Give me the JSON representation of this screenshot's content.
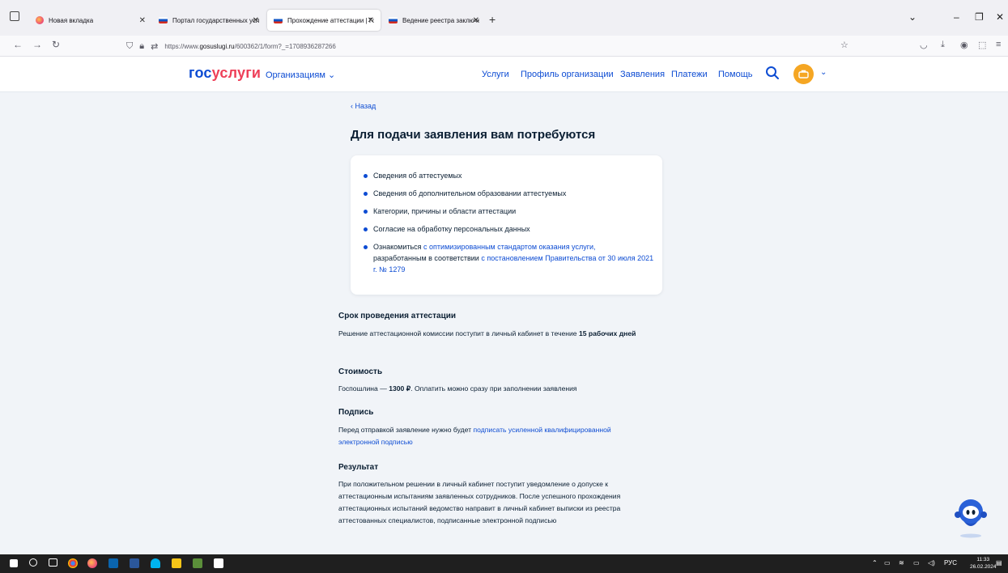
{
  "browser": {
    "tabs": [
      {
        "label": "Новая вкладка",
        "favicon": "firefox-icon",
        "active": false
      },
      {
        "label": "Портал государственных услуг",
        "favicon": "gosuslugi-flag-icon",
        "active": false
      },
      {
        "label": "Прохождение аттестации | Гос",
        "favicon": "gosuslugi-flag-icon",
        "active": true
      },
      {
        "label": "Ведение реестра заключений",
        "favicon": "gosuslugi-flag-icon",
        "active": false
      }
    ],
    "url_prefix": "https://www.",
    "url_domain": "gosuslugi.ru",
    "url_path": "/600362/1/form?_=1708936287266"
  },
  "site": {
    "logo_part1": "гос",
    "logo_part2": "услуги",
    "org_menu": "Организациям",
    "nav": [
      "Услуги",
      "Профиль организации",
      "Заявления",
      "Платежи",
      "Помощь"
    ],
    "accent": "#0d4cd3",
    "brand_red": "#ee3f58"
  },
  "page": {
    "back": "Назад",
    "title": "Для подачи заявления вам потребуются",
    "requirements": [
      "Сведения об аттестуемых",
      "Сведения об дополнительном образовании аттестуемых",
      "Категории, причины и области аттестации",
      "Согласие на обработку персональных данных"
    ],
    "last_item": {
      "prefix": "Ознакомиться ",
      "link1": "с оптимизированным стандартом оказания услуги,",
      "middle": "разработанным в соответствии ",
      "link2": "с постановлением Правительства от 30 июля 2021 г. № 1279"
    },
    "term": {
      "heading": "Срок проведения аттестации",
      "text": "Решение аттестационной комиссии поступит в личный кабинет в течение ",
      "bold": "15 рабочих дней"
    },
    "cost": {
      "heading": "Стоимость",
      "prefix": "Госпошлина — ",
      "amount": "1300 ₽",
      "suffix": ". Оплатить можно сразу при заполнении заявления"
    },
    "signature": {
      "heading": "Подпись",
      "prefix": "Перед отправкой заявление нужно будет ",
      "link": "подписать усиленной квалифицированной электронной подписью"
    },
    "result": {
      "heading": "Результат",
      "text": "При положительном решении в личный кабинет поступит уведомление о допуске к аттестационным испытаниям заявленных сотрудников. После успешного прохождения аттестационных испытаний ведомство направит в личный кабинет выписки из реестра аттестованных специалистов, подписанные электронной подписью"
    }
  },
  "taskbar": {
    "lang": "РУС",
    "time": "11:33",
    "date": "26.02.2024"
  }
}
